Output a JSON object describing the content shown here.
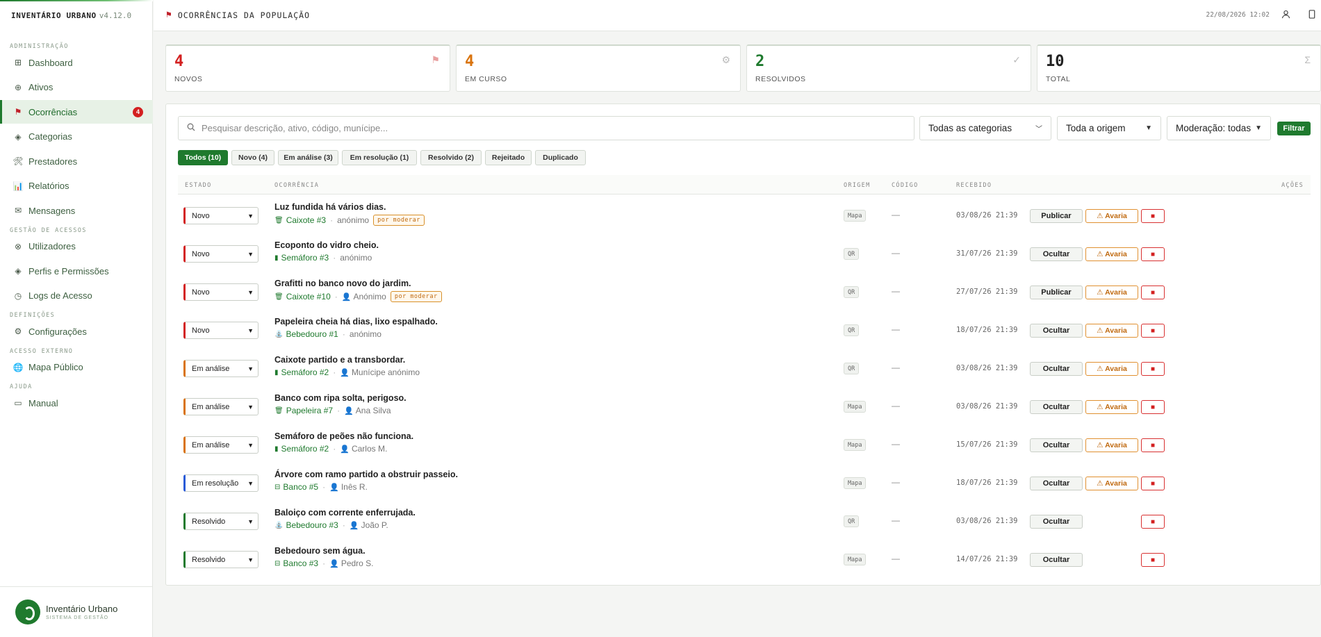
{
  "sidebar": {
    "brand": "INVENTÁRIO URBANO",
    "version": "v4.12.0",
    "sections": [
      {
        "title": "ADMINISTRAÇÃO",
        "items": [
          {
            "label": "Dashboard",
            "icon": "grid-icon"
          },
          {
            "label": "Ativos",
            "icon": "globe-icon"
          },
          {
            "label": "Ocorrências",
            "icon": "flag-icon",
            "active": true,
            "badge": "4"
          },
          {
            "label": "Categorias",
            "icon": "diamond-icon"
          },
          {
            "label": "Prestadores",
            "icon": "tools-icon"
          },
          {
            "label": "Relatórios",
            "icon": "chart-icon"
          },
          {
            "label": "Mensagens",
            "icon": "mail-icon"
          }
        ]
      },
      {
        "title": "GESTÃO DE ACESSOS",
        "items": [
          {
            "label": "Utilizadores",
            "icon": "users-icon"
          },
          {
            "label": "Perfis e Permissões",
            "icon": "diamond-icon"
          },
          {
            "label": "Logs de Acesso",
            "icon": "clock-icon"
          }
        ]
      },
      {
        "title": "DEFINIÇÕES",
        "items": [
          {
            "label": "Configurações",
            "icon": "gear-icon"
          }
        ]
      },
      {
        "title": "ACESSO EXTERNO",
        "items": [
          {
            "label": "Mapa Público",
            "icon": "world-icon"
          }
        ]
      },
      {
        "title": "AJUDA",
        "items": [
          {
            "label": "Manual",
            "icon": "book-icon"
          }
        ]
      }
    ],
    "footer": {
      "title": "Inventário Urbano",
      "subtitle": "SISTEMA DE GESTÃO"
    }
  },
  "topbar": {
    "title": "OCORRÊNCIAS DA POPULAÇÃO",
    "datetime": "22/08/2026 12:02"
  },
  "stats": [
    {
      "value": "4",
      "label": "NOVOS",
      "color": "#d32020",
      "icon": "⚑"
    },
    {
      "value": "4",
      "label": "EM CURSO",
      "color": "#d9730d",
      "icon": "⚙"
    },
    {
      "value": "2",
      "label": "RESOLVIDOS",
      "color": "#1f7a2e",
      "icon": "✓"
    },
    {
      "value": "10",
      "label": "TOTAL",
      "color": "#222222",
      "icon": "Σ"
    }
  ],
  "filters": {
    "search_placeholder": "Pesquisar descrição, ativo, código, munícipe...",
    "category": "Todas as categorias",
    "origin": "Toda a origem",
    "moderation": "Moderação: todas",
    "filter_label": "Filtrar"
  },
  "chips": [
    {
      "label": "Todos (10)",
      "active": true
    },
    {
      "label": "Novo (4)"
    },
    {
      "label": "Em análise (3)"
    },
    {
      "label": "Em resolução (1)"
    },
    {
      "label": "Resolvido (2)"
    },
    {
      "label": "Rejeitado"
    },
    {
      "label": "Duplicado"
    }
  ],
  "table": {
    "headers": {
      "estado": "ESTADO",
      "ocorrencia": "OCORRÊNCIA",
      "origem": "ORIGEM",
      "codigo": "CÓDIGO",
      "recebido": "RECEBIDO",
      "acoes": "AÇÕES"
    },
    "moderate_label": "por moderar",
    "avaria_label": "⚠ Avaria",
    "rows": [
      {
        "status": "Novo",
        "status_color": "#d32020",
        "title": "Luz fundida há vários dias.",
        "asset": "Caixote #3",
        "asset_icon": "🗑",
        "user": "anónimo",
        "user_icon": false,
        "moderate": true,
        "origin": "Mapa",
        "code": "—",
        "received": "03/08/26 21:39",
        "action": "Publicar",
        "avaria": true
      },
      {
        "status": "Novo",
        "status_color": "#d32020",
        "title": "Ecoponto do vidro cheio.",
        "asset": "Semáforo #3",
        "asset_icon": "▮",
        "user": "anónimo",
        "user_icon": false,
        "moderate": false,
        "origin": "QR",
        "code": "—",
        "received": "31/07/26 21:39",
        "action": "Ocultar",
        "avaria": true
      },
      {
        "status": "Novo",
        "status_color": "#d32020",
        "title": "Grafitti no banco novo do jardim.",
        "asset": "Caixote #10",
        "asset_icon": "🗑",
        "user": "Anónimo",
        "user_icon": true,
        "moderate": true,
        "origin": "QR",
        "code": "—",
        "received": "27/07/26 21:39",
        "action": "Publicar",
        "avaria": true
      },
      {
        "status": "Novo",
        "status_color": "#d32020",
        "title": "Papeleira cheia há dias, lixo espalhado.",
        "asset": "Bebedouro #1",
        "asset_icon": "⛲",
        "user": "anónimo",
        "user_icon": false,
        "moderate": false,
        "origin": "QR",
        "code": "—",
        "received": "18/07/26 21:39",
        "action": "Ocultar",
        "avaria": true
      },
      {
        "status": "Em análise",
        "status_color": "#d9730d",
        "title": "Caixote partido e a transbordar.",
        "asset": "Semáforo #2",
        "asset_icon": "▮",
        "user": "Munícipe anónimo",
        "user_icon": true,
        "moderate": false,
        "origin": "QR",
        "code": "—",
        "received": "03/08/26 21:39",
        "action": "Ocultar",
        "avaria": true
      },
      {
        "status": "Em análise",
        "status_color": "#d9730d",
        "title": "Banco com ripa solta, perigoso.",
        "asset": "Papeleira #7",
        "asset_icon": "🗑",
        "user": "Ana Silva",
        "user_icon": true,
        "moderate": false,
        "origin": "Mapa",
        "code": "—",
        "received": "03/08/26 21:39",
        "action": "Ocultar",
        "avaria": true
      },
      {
        "status": "Em análise",
        "status_color": "#d9730d",
        "title": "Semáforo de peões não funciona.",
        "asset": "Semáforo #2",
        "asset_icon": "▮",
        "user": "Carlos M.",
        "user_icon": true,
        "moderate": false,
        "origin": "Mapa",
        "code": "—",
        "received": "15/07/26 21:39",
        "action": "Ocultar",
        "avaria": true
      },
      {
        "status": "Em resolução",
        "status_color": "#2a5bd7",
        "title": "Árvore com ramo partido a obstruir passeio.",
        "asset": "Banco #5",
        "asset_icon": "⊟",
        "user": "Inês R.",
        "user_icon": true,
        "moderate": false,
        "origin": "Mapa",
        "code": "—",
        "received": "18/07/26 21:39",
        "action": "Ocultar",
        "avaria": true
      },
      {
        "status": "Resolvido",
        "status_color": "#1f7a2e",
        "title": "Baloiço com corrente enferrujada.",
        "asset": "Bebedouro #3",
        "asset_icon": "⛲",
        "user": "João P.",
        "user_icon": true,
        "moderate": false,
        "origin": "QR",
        "code": "—",
        "received": "03/08/26 21:39",
        "action": "Ocultar",
        "avaria": false
      },
      {
        "status": "Resolvido",
        "status_color": "#1f7a2e",
        "title": "Bebedouro sem água.",
        "asset": "Banco #3",
        "asset_icon": "⊟",
        "user": "Pedro S.",
        "user_icon": true,
        "moderate": false,
        "origin": "Mapa",
        "code": "—",
        "received": "14/07/26 21:39",
        "action": "Ocultar",
        "avaria": false
      }
    ]
  }
}
